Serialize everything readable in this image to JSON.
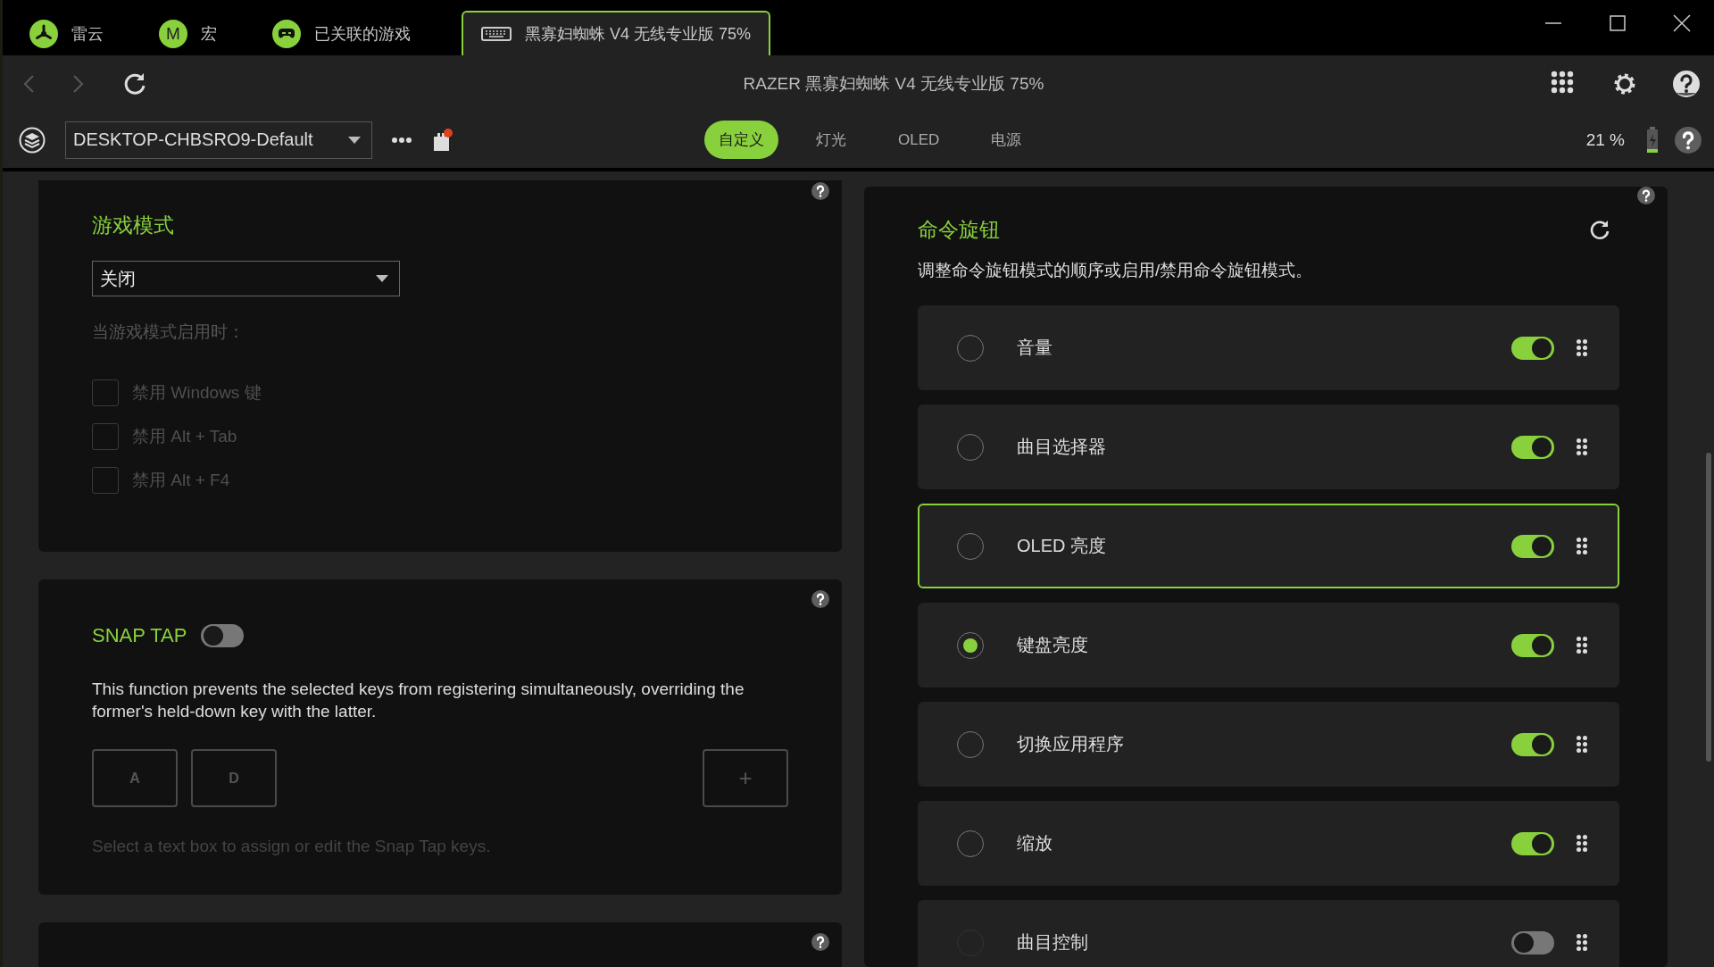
{
  "window_tabs": [
    {
      "label": "雷云",
      "kind": "logo",
      "selected": false
    },
    {
      "label": "宏",
      "kind": "letter",
      "badge": "M",
      "selected": false
    },
    {
      "label": "已关联的游戏",
      "kind": "controller",
      "selected": false
    },
    {
      "label": "黑寡妇蜘蛛 V4 无线专业版 75%",
      "kind": "keyboard",
      "selected": true
    }
  ],
  "title": "RAZER 黑寡妇蜘蛛 V4 无线专业版 75%",
  "profile": {
    "value": "DESKTOP-CHBSRO9-Default",
    "alert": true
  },
  "nav_tabs": [
    {
      "label": "自定义",
      "selected": true
    },
    {
      "label": "灯光",
      "selected": false
    },
    {
      "label": "OLED",
      "selected": false
    },
    {
      "label": "电源",
      "selected": false
    }
  ],
  "battery": {
    "reading": "21 %"
  },
  "game_mode": {
    "title": "游戏模式",
    "select": {
      "value": "关闭"
    },
    "subtitle": "当游戏模式启用时：",
    "options": [
      {
        "label": "禁用 Windows 键",
        "checked": false,
        "disabled": true
      },
      {
        "label": "禁用 Alt + Tab",
        "checked": false,
        "disabled": true
      },
      {
        "label": "禁用 Alt + F4",
        "checked": false,
        "disabled": true
      }
    ]
  },
  "snap_tap": {
    "title": "SNAP TAP",
    "on": false,
    "description": "This function prevents the selected keys from registering simultaneously, overriding the former's held-down key with the latter.",
    "keys": [
      "A",
      "D"
    ],
    "add": "+",
    "hint": "Select a text box to assign or edit the Snap Tap keys."
  },
  "command_dial": {
    "title": "命令旋钮",
    "description": "调整命令旋钮模式的顺序或启用/禁用命令旋钮模式。",
    "modes": [
      {
        "label": "音量",
        "selected": false,
        "on": true,
        "highlighted": false
      },
      {
        "label": "曲目选择器",
        "selected": false,
        "on": true,
        "highlighted": false
      },
      {
        "label": "OLED 亮度",
        "selected": false,
        "on": true,
        "highlighted": true
      },
      {
        "label": "键盘亮度",
        "selected": true,
        "on": true,
        "highlighted": false
      },
      {
        "label": "切换应用程序",
        "selected": false,
        "on": true,
        "highlighted": false
      },
      {
        "label": "缩放",
        "selected": false,
        "on": true,
        "highlighted": false
      },
      {
        "label": "曲目控制",
        "selected": false,
        "on": false,
        "highlighted": false
      }
    ]
  }
}
